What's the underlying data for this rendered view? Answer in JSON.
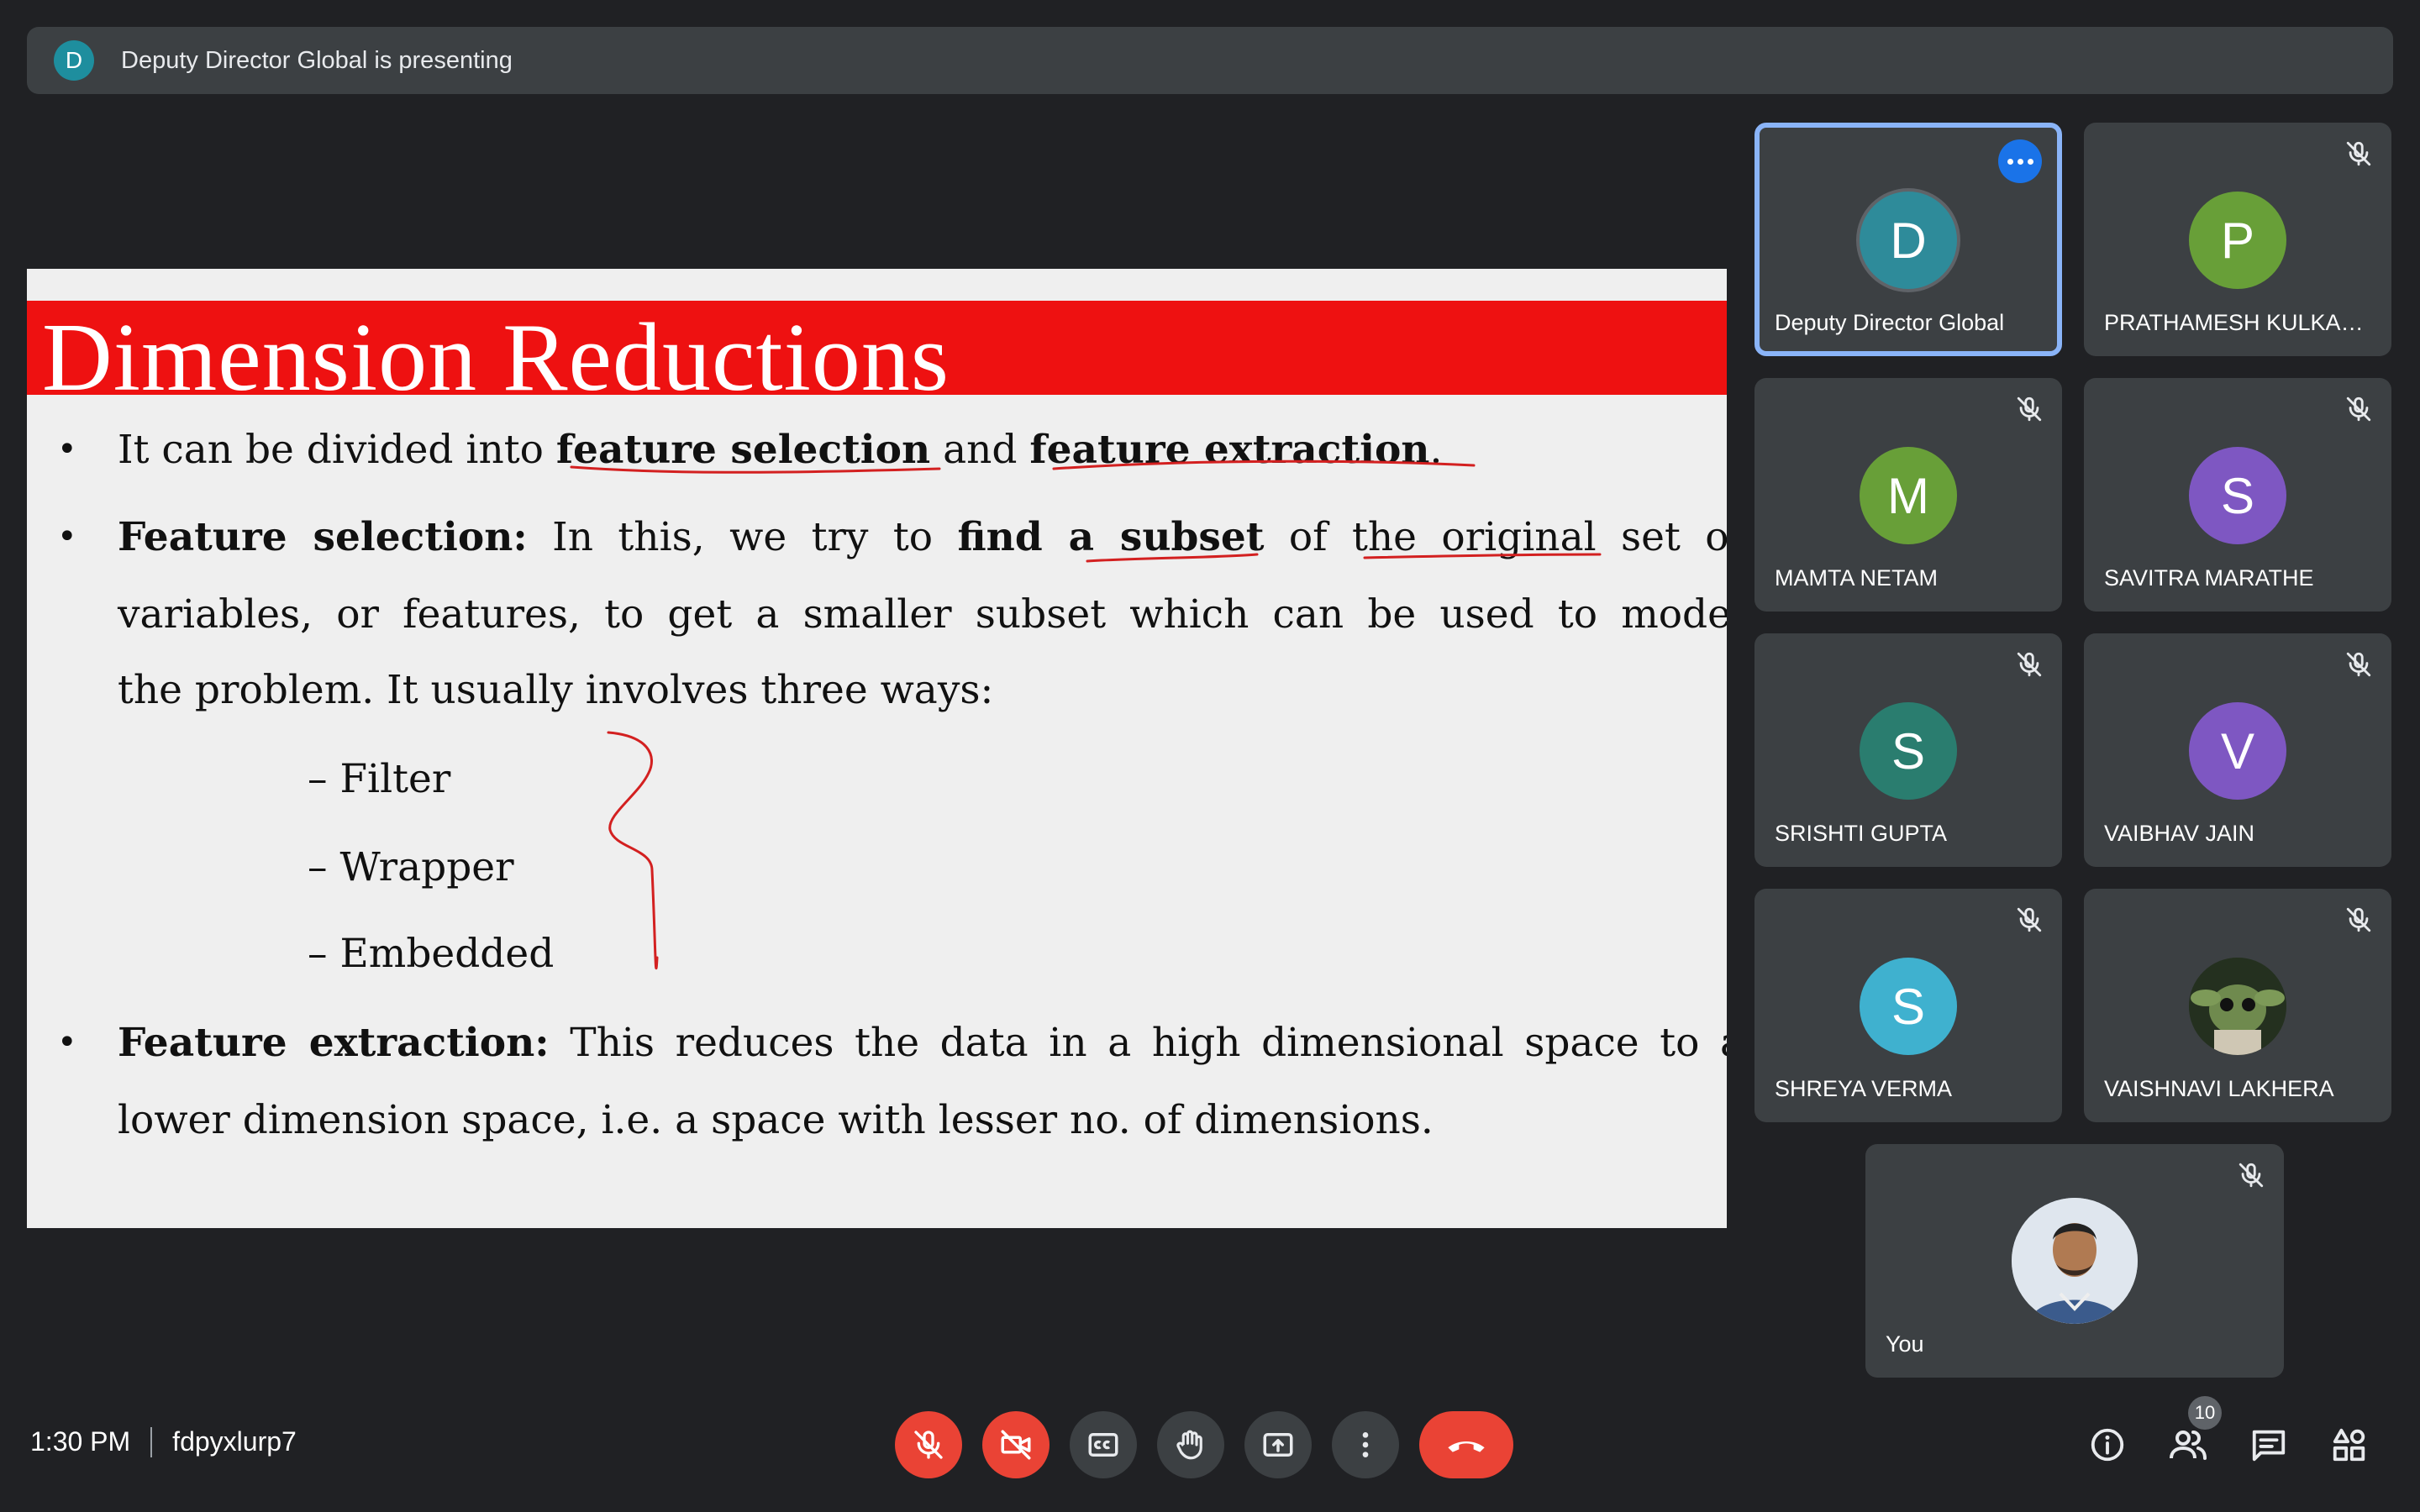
{
  "banner": {
    "avatar_letter": "D",
    "text": "Deputy Director Global is presenting"
  },
  "slide": {
    "title": "Dimension Reductions",
    "bullet1": {
      "pre": "It can be divided into ",
      "term1": "feature selection",
      "mid": " and ",
      "term2": "feature extraction",
      "post": "."
    },
    "bullet2": {
      "lead": "Feature selection:",
      "l1_a": " In this, we try to ",
      "l1_b": "find a subset",
      "l1_c": " of the original set of",
      "line2": "variables, or features, to get a smaller subset which can be used to model",
      "line3": "the problem. It usually involves three ways:",
      "sub_items": [
        "– Filter",
        "– Wrapper",
        "– Embedded"
      ]
    },
    "bullet3": {
      "lead": "Feature extraction:",
      "line1_rest": " This reduces the data in a high dimensional space to a",
      "line2": "lower dimension space, i.e. a space with lesser no. of dimensions."
    },
    "bullet_glyph": "•"
  },
  "participants": [
    {
      "name": "Deputy Director Global",
      "letter": "D",
      "color": "#2e8b9a",
      "active": true,
      "muted": false
    },
    {
      "name": "PRATHAMESH KULKAR...",
      "letter": "P",
      "color": "#689f38",
      "muted": true
    },
    {
      "name": "MAMTA NETAM",
      "letter": "M",
      "color": "#689f38",
      "muted": true
    },
    {
      "name": "SAVITRA MARATHE",
      "letter": "S",
      "color": "#7e57c2",
      "muted": true
    },
    {
      "name": "SRISHTI GUPTA",
      "letter": "S",
      "color": "#2a7d6f",
      "muted": true
    },
    {
      "name": "VAIBHAV JAIN",
      "letter": "V",
      "color": "#7e57c2",
      "muted": true
    },
    {
      "name": "SHREYA VERMA",
      "letter": "S",
      "color": "#3fb1cf",
      "muted": true
    },
    {
      "name": "VAISHNAVI LAKHERA",
      "letter": "",
      "color": "#2f3b2a",
      "muted": true,
      "photo": true
    },
    {
      "name": "You",
      "letter": "",
      "color": "#c9d4df",
      "muted": true,
      "photo": true
    }
  ],
  "bottom_bar": {
    "time": "1:30 PM",
    "meeting_code": "fdpyxlurp7",
    "people_count": "10",
    "controls": [
      "mic-off",
      "camera-off",
      "captions",
      "raise-hand",
      "present",
      "more-options",
      "leave-call"
    ],
    "side": [
      "meeting-details",
      "people",
      "chat",
      "activities"
    ]
  }
}
